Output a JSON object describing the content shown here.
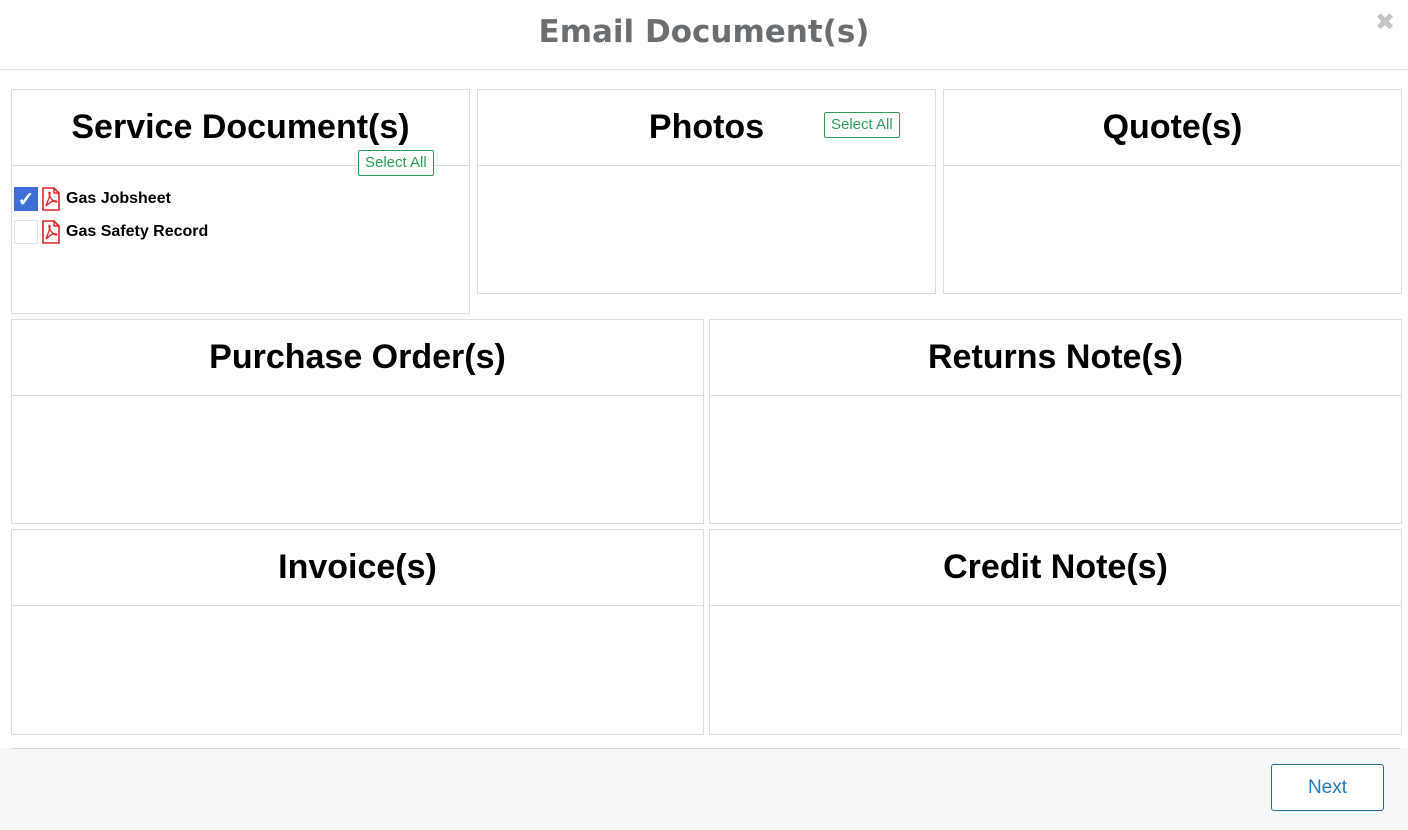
{
  "modal": {
    "title": "Email Document(s)",
    "close_icon": "close-icon"
  },
  "panels": {
    "service_documents": {
      "title": "Service Document(s)",
      "select_all_label": "Select All",
      "items": [
        {
          "label": "Gas Jobsheet",
          "checked": true,
          "icon": "pdf-icon"
        },
        {
          "label": "Gas Safety Record",
          "checked": false,
          "icon": "pdf-icon"
        }
      ]
    },
    "photos": {
      "title": "Photos",
      "select_all_label": "Select All"
    },
    "quotes": {
      "title": "Quote(s)"
    },
    "purchase_orders": {
      "title": "Purchase Order(s)"
    },
    "returns_notes": {
      "title": "Returns Note(s)"
    },
    "invoices": {
      "title": "Invoice(s)"
    },
    "credit_notes": {
      "title": "Credit Note(s)"
    }
  },
  "footer": {
    "next_label": "Next"
  },
  "colors": {
    "accent_green": "#2e9e54",
    "checkbox_checked": "#3d6fd6",
    "pdf_red": "#e02424",
    "next_blue": "#1d7bc1",
    "title_grey": "#6b6e70"
  }
}
